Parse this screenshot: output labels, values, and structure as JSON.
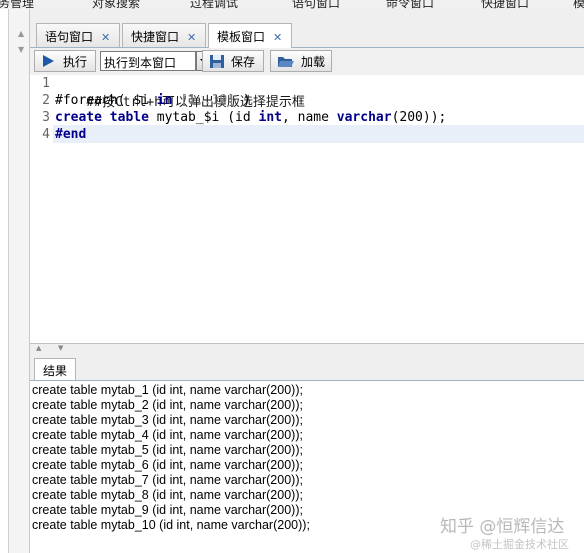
{
  "top_menu": [
    "务管理",
    "对象搜索",
    "过程调试",
    "语句窗口",
    "命令窗口",
    "快捷窗口",
    "模"
  ],
  "tabs": [
    {
      "label": "语句窗口",
      "close": "✕"
    },
    {
      "label": "快捷窗口",
      "close": "✕"
    },
    {
      "label": "模板窗口",
      "close": "✕"
    }
  ],
  "toolbar": {
    "execute_label": "执行",
    "target_select_value": "执行到本窗口",
    "save_label": "保存",
    "load_label": "加载"
  },
  "editor": {
    "line_numbers": [
      "1",
      "2",
      "3",
      "4"
    ],
    "line1": "##按Ctrl+h可以弹出模版选择提示框",
    "line2": {
      "a": "#foreach( $i ",
      "kw": "in",
      "b": " ",
      "range": "[1..10]",
      "c": " )"
    },
    "line3": {
      "kw1": "create table",
      "a": " mytab_$i (id ",
      "kw2": "int",
      "b": ", name ",
      "kw3": "varchar",
      "c": "(200));"
    },
    "line4": "#end"
  },
  "results": {
    "tab_label": "结果",
    "lines": [
      "create table mytab_1 (id int, name varchar(200));",
      "create table mytab_2 (id int, name varchar(200));",
      "create table mytab_3 (id int, name varchar(200));",
      "create table mytab_4 (id int, name varchar(200));",
      "create table mytab_5 (id int, name varchar(200));",
      "create table mytab_6 (id int, name varchar(200));",
      "create table mytab_7 (id int, name varchar(200));",
      "create table mytab_8 (id int, name varchar(200));",
      "create table mytab_9 (id int, name varchar(200));",
      "create table mytab_10 (id int, name varchar(200));"
    ]
  },
  "watermark": {
    "main": "知乎 @恒辉信达",
    "sub": "@稀土掘金技术社区"
  },
  "colors": {
    "keyword": "#00008b",
    "current_line": "#e9eff8",
    "close_x": "#3c6fb0"
  }
}
